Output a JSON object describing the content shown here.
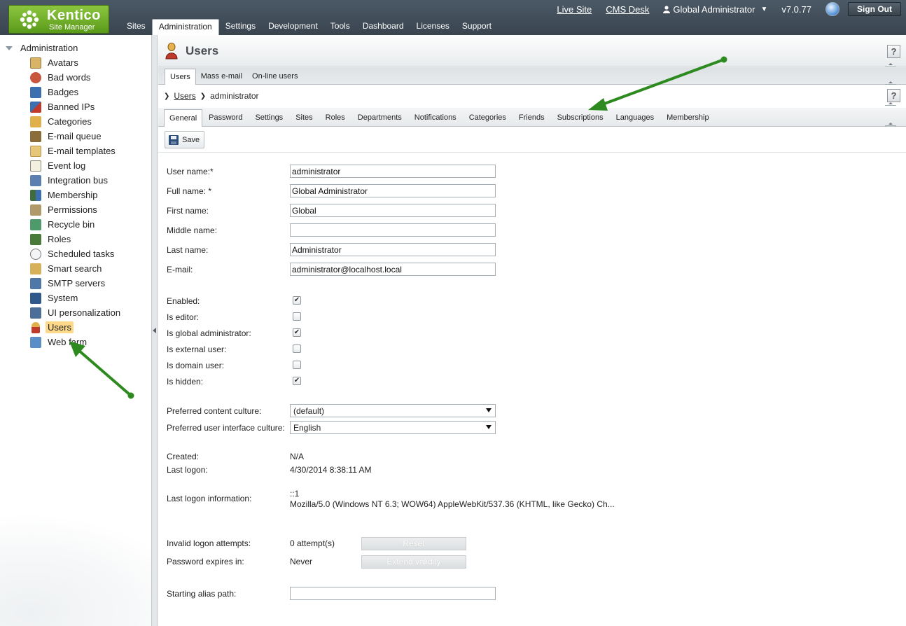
{
  "header": {
    "logo_name": "Kentico",
    "logo_sub": "Site Manager",
    "tabs": [
      {
        "label": "Sites"
      },
      {
        "label": "Administration"
      },
      {
        "label": "Settings"
      },
      {
        "label": "Development"
      },
      {
        "label": "Tools"
      },
      {
        "label": "Dashboard"
      },
      {
        "label": "Licenses"
      },
      {
        "label": "Support"
      }
    ],
    "live_site": "Live Site",
    "cms_desk": "CMS Desk",
    "user": "Global Administrator",
    "version": "v7.0.77",
    "sign_out": "Sign Out"
  },
  "sidebar": {
    "root": "Administration",
    "items": [
      {
        "label": "Avatars",
        "icon": "avatar-icon",
        "color": "#d8b46a"
      },
      {
        "label": "Bad words",
        "icon": "bad-words-icon",
        "color": "#c8553d"
      },
      {
        "label": "Badges",
        "icon": "badge-icon",
        "color": "#3c6fb0"
      },
      {
        "label": "Banned IPs",
        "icon": "banned-ip-icon",
        "color": "#c0392b"
      },
      {
        "label": "Categories",
        "icon": "categories-icon",
        "color": "#e0b14a"
      },
      {
        "label": "E-mail queue",
        "icon": "email-queue-icon",
        "color": "#8a6d3b"
      },
      {
        "label": "E-mail templates",
        "icon": "email-template-icon",
        "color": "#e6c77a"
      },
      {
        "label": "Event log",
        "icon": "event-log-icon",
        "color": "#f3f0e0"
      },
      {
        "label": "Integration bus",
        "icon": "integration-bus-icon",
        "color": "#5a7fb0"
      },
      {
        "label": "Membership",
        "icon": "membership-icon",
        "color": "#3f6c3a"
      },
      {
        "label": "Permissions",
        "icon": "permissions-icon",
        "color": "#b09a6a"
      },
      {
        "label": "Recycle bin",
        "icon": "recycle-bin-icon",
        "color": "#4e9a6a"
      },
      {
        "label": "Roles",
        "icon": "roles-icon",
        "color": "#4a7a3a"
      },
      {
        "label": "Scheduled tasks",
        "icon": "clock-icon",
        "color": "#c9ccd0"
      },
      {
        "label": "Smart search",
        "icon": "smart-search-icon",
        "color": "#d6b15a"
      },
      {
        "label": "SMTP servers",
        "icon": "smtp-server-icon",
        "color": "#4f77a8"
      },
      {
        "label": "System",
        "icon": "system-icon",
        "color": "#31588a"
      },
      {
        "label": "UI personalization",
        "icon": "ui-personalization-icon",
        "color": "#4d6e98"
      },
      {
        "label": "Users",
        "icon": "users-icon",
        "color": "#c0392b"
      },
      {
        "label": "Web farm",
        "icon": "web-farm-icon",
        "color": "#5b8ec7"
      }
    ],
    "selected": "Users"
  },
  "page": {
    "title": "Users",
    "sub_tabs": [
      {
        "label": "Users"
      },
      {
        "label": "Mass e-mail"
      },
      {
        "label": "On-line users"
      }
    ],
    "breadcrumb": {
      "link": "Users",
      "current": "administrator"
    },
    "user_tabs": [
      {
        "label": "General"
      },
      {
        "label": "Password"
      },
      {
        "label": "Settings"
      },
      {
        "label": "Sites"
      },
      {
        "label": "Roles"
      },
      {
        "label": "Departments"
      },
      {
        "label": "Notifications"
      },
      {
        "label": "Categories"
      },
      {
        "label": "Friends"
      },
      {
        "label": "Subscriptions"
      },
      {
        "label": "Languages"
      },
      {
        "label": "Membership"
      }
    ],
    "help": "?",
    "save": "Save"
  },
  "form": {
    "user_name_label": "User name:*",
    "user_name": "administrator",
    "full_name_label": "Full name: *",
    "full_name": "Global Administrator",
    "first_name_label": "First name:",
    "first_name": "Global",
    "middle_name_label": "Middle name:",
    "middle_name": "",
    "last_name_label": "Last name:",
    "last_name": "Administrator",
    "email_label": "E-mail:",
    "email": "administrator@localhost.local",
    "checks": [
      {
        "label": "Enabled:",
        "checked": true
      },
      {
        "label": "Is editor:",
        "checked": false
      },
      {
        "label": "Is global administrator:",
        "checked": true
      },
      {
        "label": "Is external user:",
        "checked": false
      },
      {
        "label": "Is domain user:",
        "checked": false
      },
      {
        "label": "Is hidden:",
        "checked": true
      }
    ],
    "content_culture_label": "Preferred content culture:",
    "content_culture": "(default)",
    "ui_culture_label": "Preferred user interface culture:",
    "ui_culture": "English",
    "created_label": "Created:",
    "created": "N/A",
    "last_logon_label": "Last logon:",
    "last_logon": "4/30/2014 8:38:11 AM",
    "last_logon_info_label": "Last logon information:",
    "last_logon_info_ip": "::1",
    "last_logon_info_agent": "Mozilla/5.0 (Windows NT 6.3; WOW64) AppleWebKit/537.36 (KHTML, like Gecko) Ch...",
    "invalid_logon_label": "Invalid logon attempts:",
    "invalid_logon": "0 attempt(s)",
    "reset": "Reset",
    "password_expires_label": "Password expires in:",
    "password_expires": "Never",
    "extend_validity": "Extend validity",
    "starting_alias_label": "Starting alias path:",
    "starting_alias": ""
  },
  "colors": {
    "header": "#3f4a55",
    "accent_green": "#2d8a1e",
    "selected_bg": "#ffd98a"
  }
}
